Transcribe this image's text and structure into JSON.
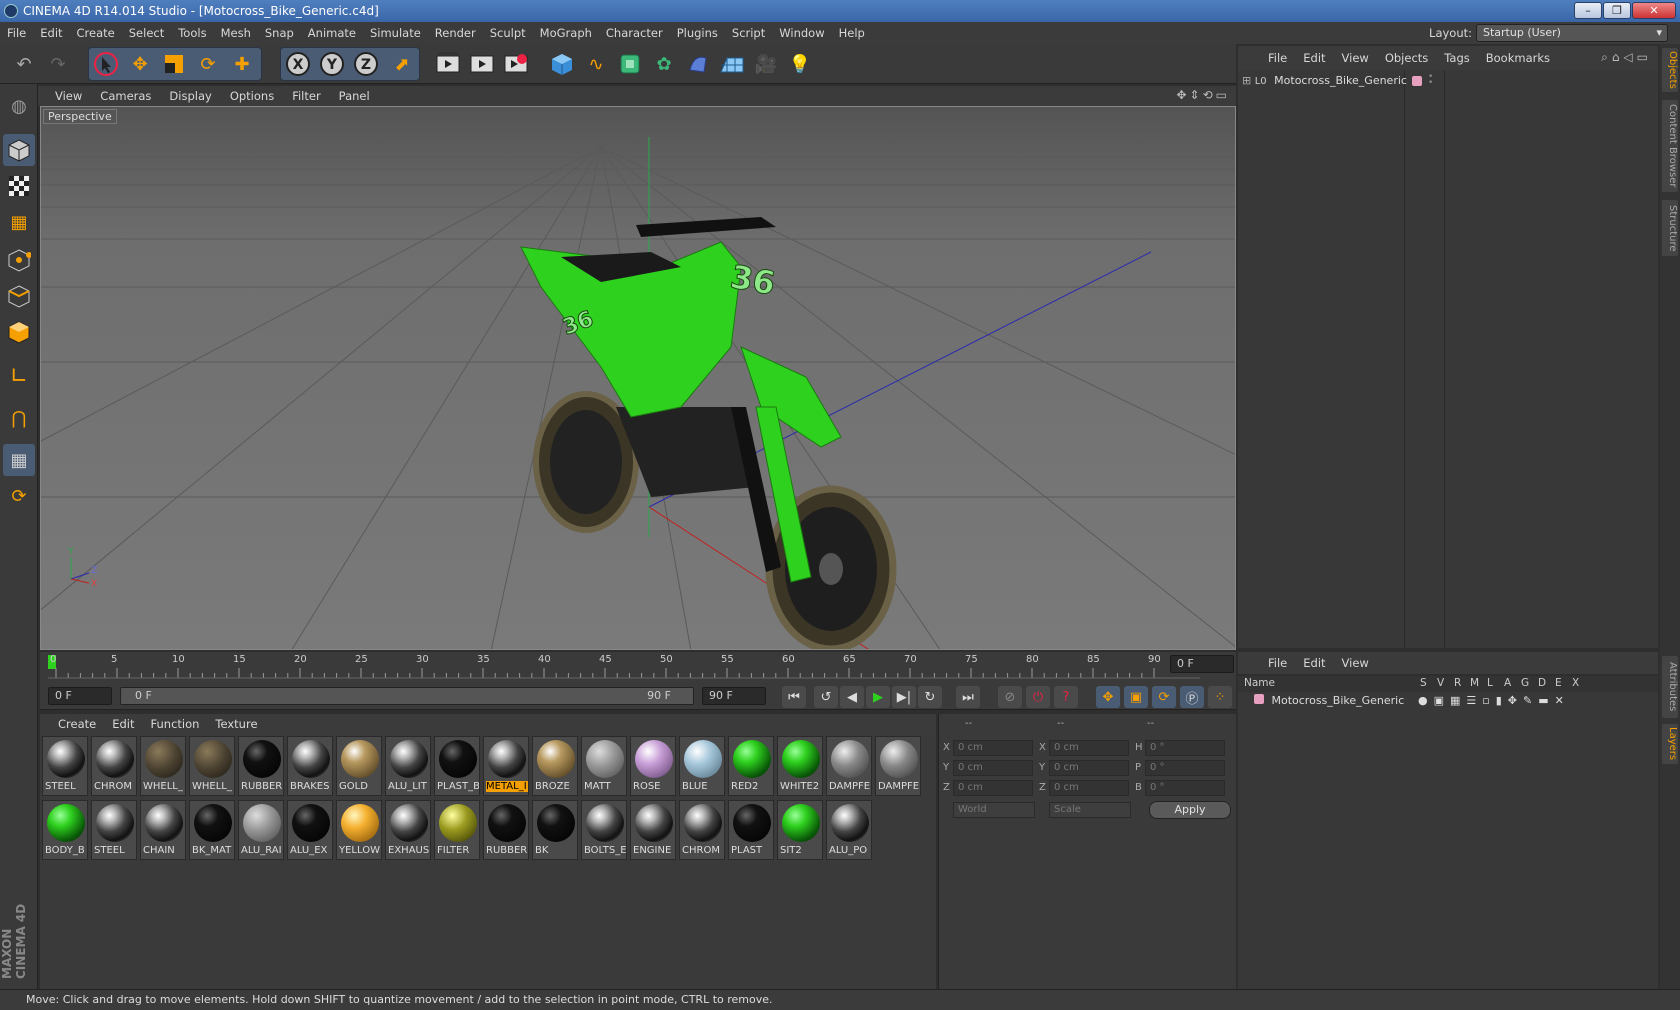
{
  "window": {
    "title": "CINEMA 4D R14.014 Studio - [Motocross_Bike_Generic.c4d]"
  },
  "menu": [
    "File",
    "Edit",
    "Create",
    "Select",
    "Tools",
    "Mesh",
    "Snap",
    "Animate",
    "Simulate",
    "Render",
    "Sculpt",
    "MoGraph",
    "Character",
    "Plugins",
    "Script",
    "Window",
    "Help"
  ],
  "layout": {
    "label": "Layout:",
    "value": "Startup (User)"
  },
  "viewport": {
    "menu": [
      "View",
      "Cameras",
      "Display",
      "Options",
      "Filter",
      "Panel"
    ],
    "label": "Perspective",
    "axis_labels": {
      "y": "Y",
      "z": "Z",
      "x": "X"
    }
  },
  "timeline": {
    "ticks": [
      "0",
      "5",
      "10",
      "15",
      "20",
      "25",
      "30",
      "35",
      "40",
      "45",
      "50",
      "55",
      "60",
      "65",
      "70",
      "75",
      "80",
      "85",
      "90"
    ],
    "current_frame": "0 F",
    "start": "0 F",
    "range_start": "0 F",
    "range_end": "90 F",
    "end": "90 F"
  },
  "material_manager": {
    "menu": [
      "Create",
      "Edit",
      "Function",
      "Texture"
    ],
    "row1": [
      "STEEL",
      "CHROM",
      "WHELL_",
      "WHELL_",
      "RUBBER",
      "BRAKES",
      "GOLD",
      "ALU_LIT",
      "PLAST_B",
      "METAL_I",
      "BROZE",
      "MATT",
      "ROSE",
      "BLUE",
      "RED2",
      "WHITE2",
      "DAMPFE",
      "DAMPFE"
    ],
    "row2": [
      "BODY_B",
      "STEEL",
      "CHAIN",
      "BK_MAT",
      "ALU_RAI",
      "ALU_EX",
      "YELLOW",
      "EXHAUS",
      "FILTER",
      "RUBBER",
      "BK",
      "BOLTS_E",
      "ENGINE",
      "CHROM",
      "PLAST",
      "SIT2",
      "ALU_PO"
    ],
    "selected_label": "METAL_I"
  },
  "coordinates": {
    "headers": [
      "--",
      "--",
      "--"
    ],
    "rows": [
      {
        "l1": "X",
        "v1": "0 cm",
        "l2": "X",
        "v2": "0 cm",
        "l3": "H",
        "v3": "0 °"
      },
      {
        "l1": "Y",
        "v1": "0 cm",
        "l2": "Y",
        "v2": "0 cm",
        "l3": "P",
        "v3": "0 °"
      },
      {
        "l1": "Z",
        "v1": "0 cm",
        "l2": "Z",
        "v2": "0 cm",
        "l3": "B",
        "v3": "0 °"
      }
    ],
    "world": "World",
    "scale": "Scale",
    "apply": "Apply"
  },
  "objects_panel": {
    "menu": [
      "File",
      "Edit",
      "View",
      "Objects",
      "Tags",
      "Bookmarks"
    ],
    "object_name": "Motocross_Bike_Generic"
  },
  "layers_panel": {
    "menu": [
      "File",
      "Edit",
      "View"
    ],
    "columns": [
      "Name",
      "S",
      "V",
      "R",
      "M",
      "L",
      "A",
      "G",
      "D",
      "E",
      "X"
    ],
    "layer_name": "Motocross_Bike_Generic"
  },
  "side_tabs": [
    "Objects",
    "Content Browser",
    "Structure",
    "Attributes",
    "Layers"
  ],
  "branding": {
    "line1": "MAXON",
    "line2": "CINEMA 4D"
  },
  "status": "Move: Click and drag to move elements. Hold down SHIFT to quantize movement / add to the selection in point mode, CTRL to remove.",
  "colors": {
    "accent": "#f5a000",
    "bike_green": "#2fd11f",
    "toolbar_group": "#4a5c74"
  }
}
